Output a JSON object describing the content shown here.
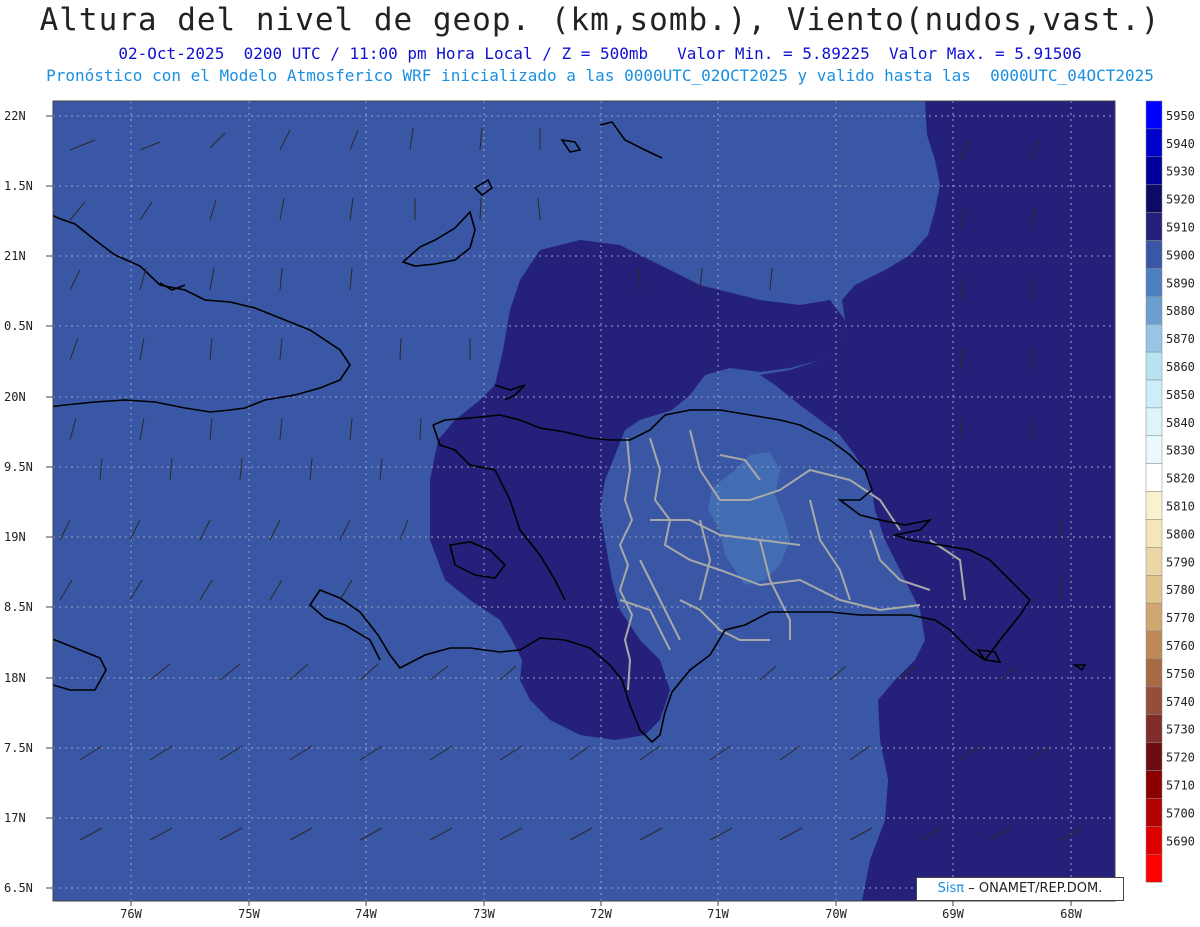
{
  "title": "Altura del nivel de geop. (km,somb.), Viento(nudos,vast.)",
  "subtitle1": "02-Oct-2025  0200 UTC / 11:00 pm Hora Local / Z = 500mb   Valor Min. = 5.89225  Valor Max. = 5.91506",
  "subtitle2": "Pronóstico con el Modelo Atmosferico WRF inicializado a las 0000UTC_02OCT2025 y valido hasta las  0000UTC_04OCT2025",
  "credit": {
    "brand": "Sisπ",
    "text": "– ONAMET/REP.DOM."
  },
  "lat_labels": [
    "22N",
    "1.5N",
    "21N",
    "0.5N",
    "20N",
    "9.5N",
    "19N",
    "8.5N",
    "18N",
    "7.5N",
    "17N",
    "6.5N"
  ],
  "lon_labels": [
    "76W",
    "75W",
    "74W",
    "73W",
    "72W",
    "71W",
    "70W",
    "69W",
    "68W"
  ],
  "colorbar": {
    "levels": [
      5950,
      5940,
      5930,
      5920,
      5910,
      5900,
      5890,
      5880,
      5870,
      5860,
      5850,
      5840,
      5830,
      5820,
      5810,
      5800,
      5790,
      5780,
      5770,
      5760,
      5750,
      5740,
      5730,
      5720,
      5710,
      5700,
      5690
    ],
    "colors": [
      "#0000ff",
      "#0000cc",
      "#000099",
      "#0d0b66",
      "#25207a",
      "#3a57a5",
      "#4b7fbf",
      "#6a9fd0",
      "#98c4e6",
      "#b8e4f2",
      "#cdeef7",
      "#dcf4fa",
      "#e9f9fc",
      "#ffffff",
      "#faf2cc",
      "#f3e6b8",
      "#ead7a5",
      "#e0c58e",
      "#cfa66f",
      "#c08a58",
      "#a86a44",
      "#944e3b",
      "#7f2c2a",
      "#6b0b12",
      "#8a0000",
      "#b50000",
      "#dd0000",
      "#ff0000"
    ]
  },
  "colors": {
    "main_fill": "#3a57a5",
    "high_fill": "#25207a",
    "low_fill": "#4b7fbf"
  }
}
